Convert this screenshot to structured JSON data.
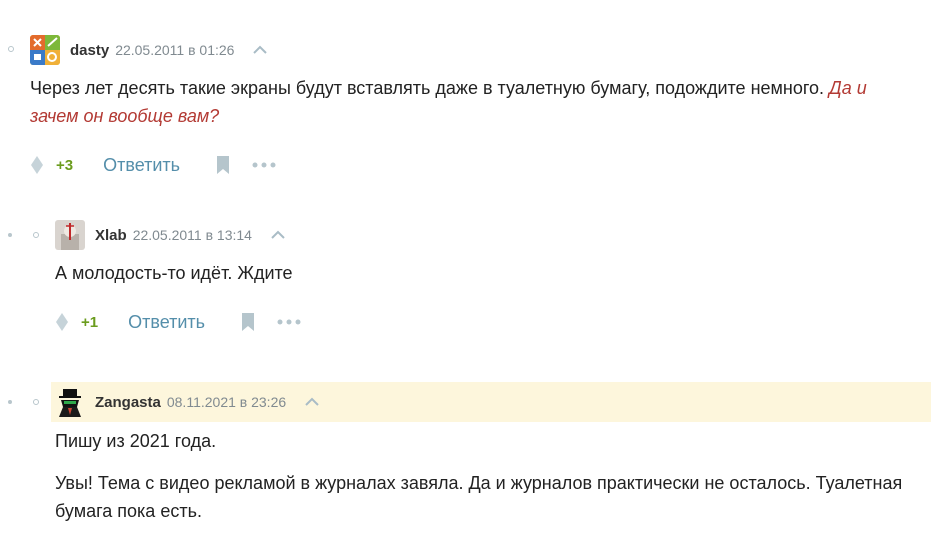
{
  "comments": [
    {
      "username": "dasty",
      "date": "22.05.2011 в 01:26",
      "text_plain": "Через лет десять такие экраны будут вставлять даже в туалетную бумагу, подождите немного. ",
      "text_quote": "Да и зачем он вообще вам?",
      "score": "+3",
      "reply_label": "Ответить"
    },
    {
      "username": "Xlab",
      "date": "22.05.2011 в 13:14",
      "text": "А молодость-то идёт. Ждите",
      "score": "+1",
      "reply_label": "Ответить"
    },
    {
      "username": "Zangasta",
      "date": "08.11.2021 в 23:26",
      "paragraphs": [
        "Пишу из 2021 года.",
        "Увы! Тема с видео рекламой в журналах завяла. Да и журналов практически не осталось. Туалетная бумага пока есть."
      ]
    }
  ],
  "colors": {
    "score_positive": "#6b9c1e",
    "reply_link": "#548eaa",
    "quote_text": "#b33a34",
    "highlight_bg": "#fdf6dc",
    "muted": "#808a90"
  }
}
